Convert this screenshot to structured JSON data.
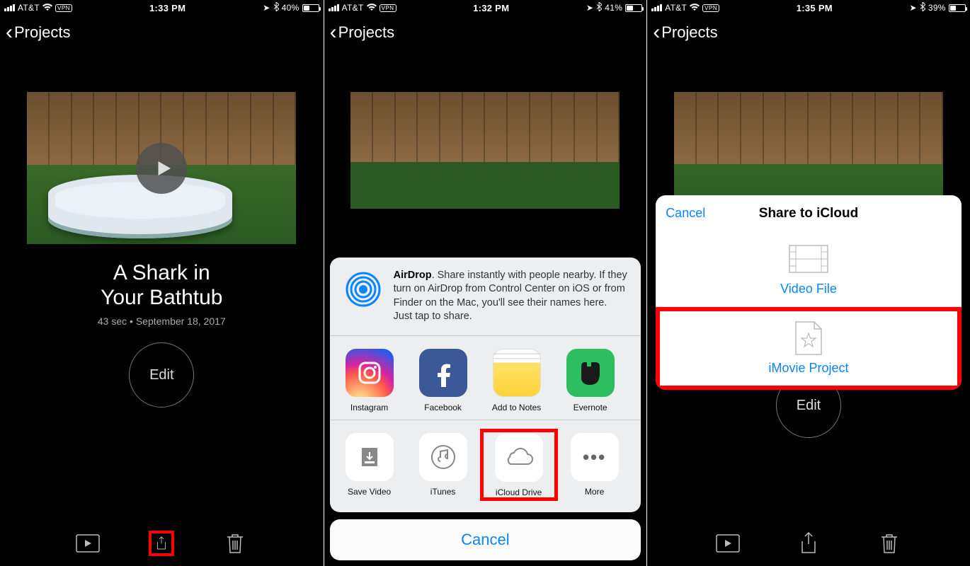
{
  "screens": [
    {
      "status": {
        "carrier": "AT&T",
        "vpn": "VPN",
        "time": "1:33 PM",
        "battery_pct": "40%"
      },
      "nav_back": "Projects",
      "project": {
        "title_line1": "A Shark in",
        "title_line2": "Your Bathtub",
        "duration": "43 sec",
        "date": "September 18, 2017"
      },
      "edit_label": "Edit",
      "toolbar": {
        "play": "play-icon",
        "share": "share-icon",
        "trash": "trash-icon"
      },
      "highlight": "share"
    },
    {
      "status": {
        "carrier": "AT&T",
        "vpn": "VPN",
        "time": "1:32 PM",
        "battery_pct": "41%"
      },
      "nav_back": "Projects",
      "airdrop": {
        "bold": "AirDrop",
        "text": ". Share instantly with people nearby. If they turn on AirDrop from Control Center on iOS or from Finder on the Mac, you'll see their names here. Just tap to share."
      },
      "share_apps": [
        {
          "id": "instagram",
          "label": "Instagram"
        },
        {
          "id": "facebook",
          "label": "Facebook"
        },
        {
          "id": "notes",
          "label": "Add to Notes"
        },
        {
          "id": "evernote",
          "label": "Evernote"
        }
      ],
      "actions": [
        {
          "id": "save-video",
          "label": "Save Video"
        },
        {
          "id": "itunes",
          "label": "iTunes"
        },
        {
          "id": "icloud-drive",
          "label": "iCloud Drive"
        },
        {
          "id": "more",
          "label": "More"
        }
      ],
      "cancel": "Cancel",
      "highlight": "icloud-drive"
    },
    {
      "status": {
        "carrier": "AT&T",
        "vpn": "VPN",
        "time": "1:35 PM",
        "battery_pct": "39%"
      },
      "nav_back": "Projects",
      "edit_label": "Edit",
      "modal": {
        "cancel": "Cancel",
        "title": "Share to iCloud",
        "options": [
          {
            "id": "video-file",
            "label": "Video File"
          },
          {
            "id": "imovie-project",
            "label": "iMovie Project"
          }
        ]
      },
      "highlight": "imovie-project",
      "toolbar": {
        "play": "play-icon",
        "share": "share-icon",
        "trash": "trash-icon"
      }
    }
  ]
}
